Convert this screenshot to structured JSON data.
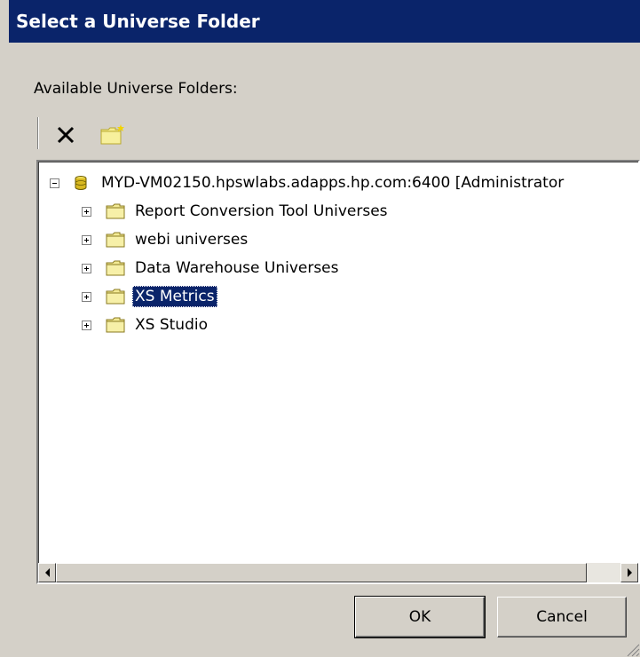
{
  "dialog": {
    "title": "Select a Universe Folder",
    "label": "Available Universe Folders:"
  },
  "toolbar": {
    "delete_icon": "delete-x-icon",
    "new_folder_icon": "new-folder-icon"
  },
  "tree": {
    "root": {
      "label": "MYD-VM02150.hpswlabs.adapps.hp.com:6400 [Administrator",
      "expanded": true,
      "icon": "database-icon"
    },
    "folders": [
      {
        "label": "Report Conversion Tool Universes",
        "selected": false
      },
      {
        "label": "webi universes",
        "selected": false
      },
      {
        "label": "Data Warehouse Universes",
        "selected": false
      },
      {
        "label": "XS Metrics",
        "selected": true
      },
      {
        "label": "XS Studio",
        "selected": false
      }
    ]
  },
  "buttons": {
    "ok": "OK",
    "cancel": "Cancel"
  },
  "colors": {
    "titlebar": "#0a246a",
    "dialog_bg": "#d4d0c8",
    "selection": "#0a246a"
  }
}
